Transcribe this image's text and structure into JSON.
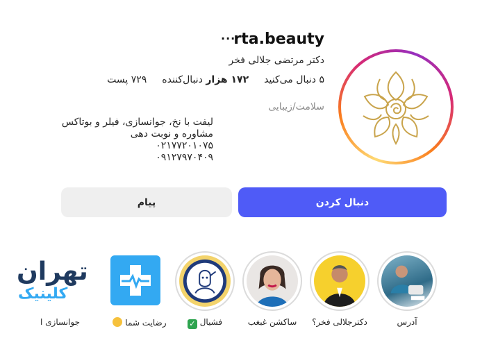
{
  "profile": {
    "username": "rta.beauty",
    "more": "···",
    "full_name": "دکتر مرتضی جلالی فخر",
    "stats": {
      "posts_label": "۷۲۹ پست",
      "followers_num": "۱۷۲ هزار",
      "followers_label": "دنبال‌کننده",
      "following_label": "۵ دنبال می‌کنید"
    },
    "category": "سلامت/زیبایی",
    "bio": [
      "لیفت با نخ، جوانسازی، فیلر و بوتاکس",
      "مشاوره و نوبت دهی",
      "۰۲۱۷۷۲۰۱۰۷۵",
      "۰۹۱۲۷۹۷۰۴۰۹"
    ]
  },
  "buttons": {
    "follow": "دنبال کردن",
    "message": "پیام"
  },
  "highlights": [
    {
      "label": "آدرس"
    },
    {
      "label": "دکترجلالی فخر؟"
    },
    {
      "label": "ساکشن غبغب"
    },
    {
      "label": "فشیال"
    },
    {
      "label": "رضایت شما"
    },
    {
      "label": "جوانسازی ا"
    }
  ],
  "brand": {
    "title": "تهران",
    "subtitle": "کلینیک"
  },
  "colors": {
    "follow_button": "#4f5bf7",
    "message_button": "#efefef",
    "brand_blue": "#33a9f2",
    "brand_dark": "#1f3a5f"
  }
}
